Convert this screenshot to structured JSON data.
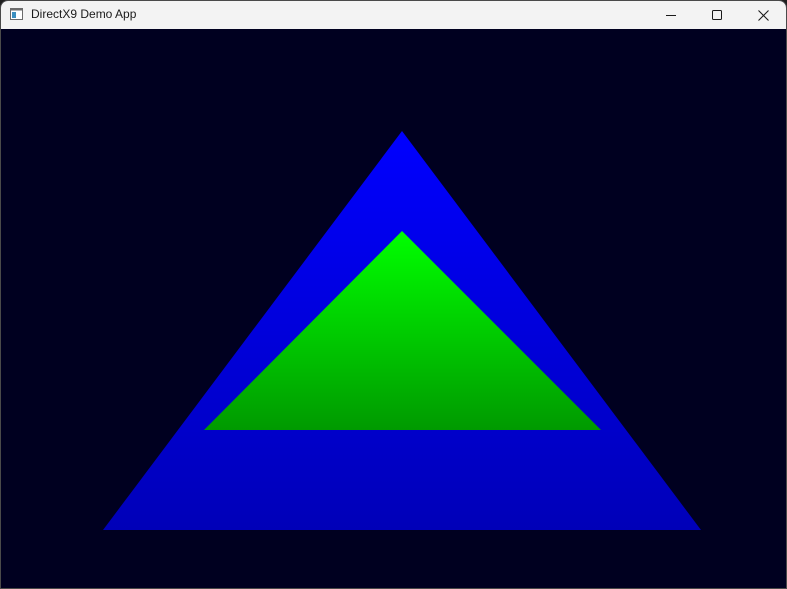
{
  "window": {
    "title": "DirectX9 Demo App",
    "controls": {
      "minimize_icon": "minimize-icon",
      "maximize_icon": "maximize-icon",
      "close_icon": "close-icon"
    }
  },
  "scene": {
    "background_color": "#000020",
    "outer_triangle": {
      "color_top": "#0000ff",
      "color_bottom": "#0000b8"
    },
    "inner_triangle": {
      "color_top": "#00ff00",
      "color_bottom": "#009a00"
    }
  }
}
